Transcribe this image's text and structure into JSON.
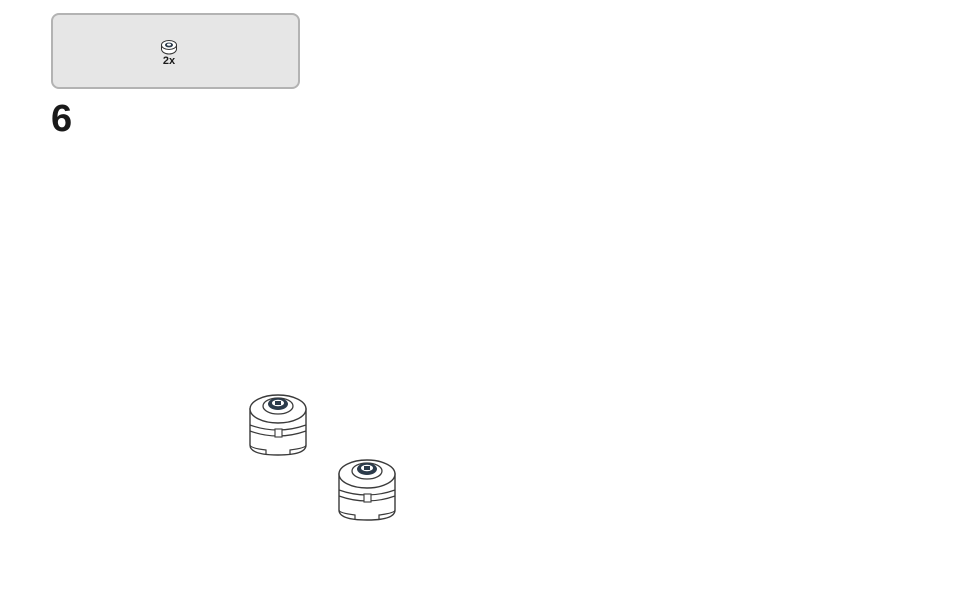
{
  "callout": {
    "part_icon": "round-brick-icon",
    "quantity_label": "2x"
  },
  "step": {
    "number": "6"
  },
  "parts_shown": [
    {
      "icon": "round-brick-icon"
    },
    {
      "icon": "round-brick-icon"
    }
  ],
  "colors": {
    "callout_background": "#e6e6e6",
    "callout_border": "#b3b3b3",
    "brick_fill": "#ffffff",
    "brick_outline": "#3a3a3a",
    "stud_dark": "#2b3a4a"
  }
}
